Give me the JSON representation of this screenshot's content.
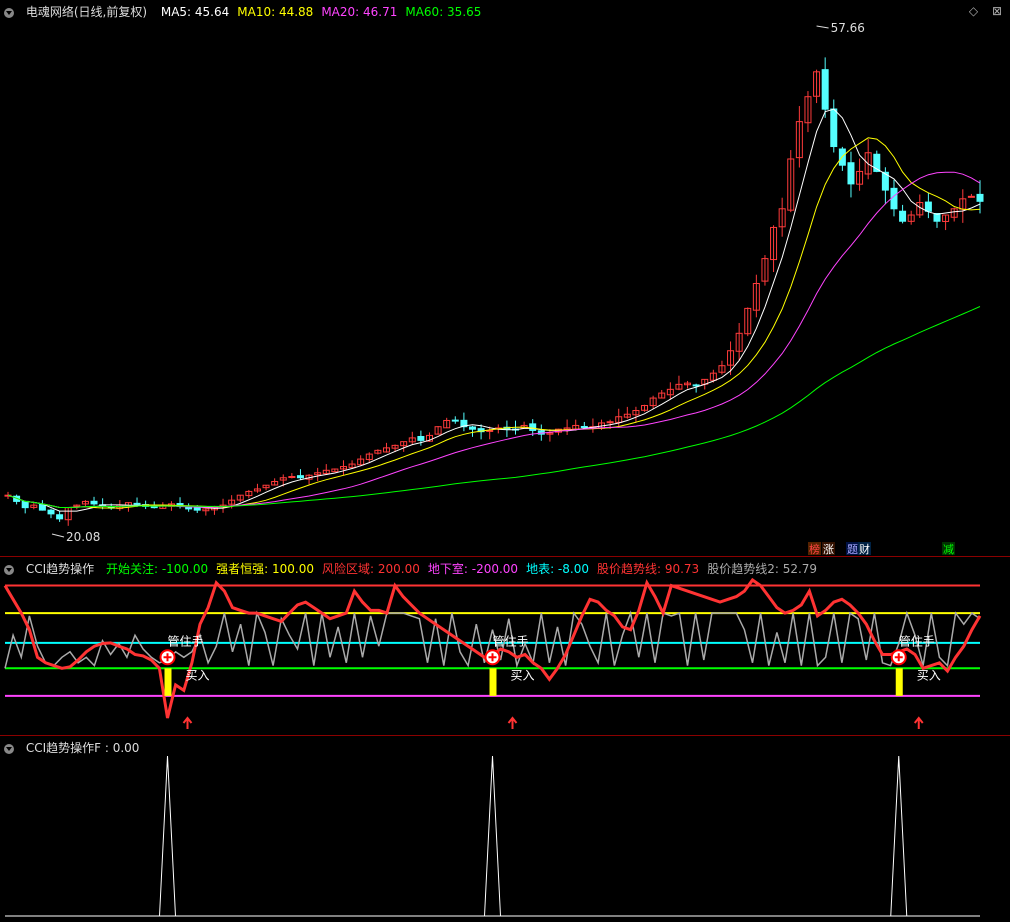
{
  "title": "电魂网络(日线,前复权)",
  "top_indicators": [
    {
      "label": "MA5: 45.64",
      "color": "#ffffff"
    },
    {
      "label": "MA10: 44.88",
      "color": "#ffff00"
    },
    {
      "label": "MA20: 46.71",
      "color": "#ff44ff"
    },
    {
      "label": "MA60: 35.65",
      "color": "#00ff00"
    }
  ],
  "top_right_icons": [
    "diamond-icon",
    "close-icon"
  ],
  "price_high_label": "57.66",
  "price_low_label": "20.08",
  "badges": [
    {
      "text": "榜",
      "color": "#ff4444",
      "bg": "#552200"
    },
    {
      "text": "涨",
      "color": "#ffffff",
      "bg": "#331100"
    },
    {
      "text": "题",
      "color": "#aaaaff",
      "bg": "#001144"
    },
    {
      "text": "财",
      "color": "#ffffff",
      "bg": "#002244"
    },
    {
      "text": "减",
      "color": "#00ff00",
      "bg": "#003300"
    }
  ],
  "cci_panel": {
    "title": "CCI趋势操作",
    "items": [
      {
        "label": "开始关注: -100.00",
        "color": "#00ff00"
      },
      {
        "label": "强者恒强: 100.00",
        "color": "#ffff00"
      },
      {
        "label": "风险区域: 200.00",
        "color": "#ff3333"
      },
      {
        "label": "地下室: -200.00",
        "color": "#ff44ff"
      },
      {
        "label": "地表: -8.00",
        "color": "#00ffff"
      },
      {
        "label": "股价趋势线: 90.73",
        "color": "#ff3333"
      },
      {
        "label": "股价趋势线2: 52.79",
        "color": "#aaaaaa"
      }
    ],
    "signal_label_1": "管住手",
    "signal_label_2": "买入"
  },
  "f_panel": {
    "title": "CCI趋势操作F",
    "value": ": 0.00"
  },
  "chart_data": [
    {
      "type": "candlestick",
      "title": "电魂网络(日线,前复权)",
      "high": 57.66,
      "low": 20.08,
      "ma_series": [
        {
          "name": "MA5",
          "value": 45.64,
          "color": "#ffffff"
        },
        {
          "name": "MA10",
          "value": 44.88,
          "color": "#ffff00"
        },
        {
          "name": "MA20",
          "value": 46.71,
          "color": "#ff44ff"
        },
        {
          "name": "MA60",
          "value": 35.65,
          "color": "#00ff00"
        }
      ],
      "close_approx": [
        22,
        21.5,
        21,
        21.2,
        20.8,
        20.5,
        20.1,
        21,
        21.2,
        21.5,
        21.3,
        21.1,
        21,
        21.2,
        21.4,
        21.3,
        21.1,
        21,
        21.2,
        21.3,
        21.1,
        20.9,
        20.8,
        20.9,
        21,
        21.2,
        21.6,
        22,
        22.3,
        22.5,
        22.8,
        23.1,
        23.4,
        23.5,
        23.4,
        23.6,
        23.8,
        24,
        24.1,
        24.3,
        24.5,
        24.9,
        25.3,
        25.6,
        25.8,
        26,
        26.3,
        26.6,
        26.4,
        26.8,
        27.5,
        28,
        28,
        27.5,
        27.3,
        27.1,
        27.2,
        27.4,
        27.3,
        27.3,
        27.6,
        27.2,
        26.9,
        27,
        27.3,
        27.4,
        27.6,
        27.5,
        27.5,
        27.8,
        27.9,
        28.3,
        28.5,
        28.8,
        29.2,
        29.8,
        30.2,
        30.5,
        30.9,
        31,
        30.8,
        31.3,
        31.8,
        32.4,
        33.6,
        35,
        37,
        39,
        41,
        43.5,
        45,
        49,
        52,
        54,
        56,
        53,
        50,
        48.5,
        47,
        48,
        49.5,
        48,
        46.5,
        45,
        44,
        44.5,
        45.5,
        44.8,
        44,
        44.5,
        45,
        45.8,
        46,
        45.6
      ]
    },
    {
      "type": "line",
      "title": "CCI趋势操作",
      "reference_lines": [
        {
          "name": "风险区域",
          "value": 200,
          "color": "#ff3333"
        },
        {
          "name": "强者恒强",
          "value": 100,
          "color": "#ffff00"
        },
        {
          "name": "地表",
          "value": -8,
          "color": "#00ffff"
        },
        {
          "name": "开始关注",
          "value": -100,
          "color": "#00ff00"
        },
        {
          "name": "地下室",
          "value": -200,
          "color": "#ff44ff"
        }
      ],
      "series": [
        {
          "name": "股价趋势线",
          "last": 90.73,
          "color": "#ff3333",
          "values": [
            200,
            150,
            100,
            40,
            -60,
            -80,
            -90,
            -100,
            -95,
            -70,
            -40,
            -20,
            -10,
            -8,
            -20,
            -30,
            -50,
            -55,
            -70,
            -100,
            -280,
            -160,
            -180,
            -80,
            60,
            120,
            210,
            180,
            120,
            110,
            100,
            100,
            90,
            80,
            70,
            100,
            130,
            140,
            120,
            100,
            80,
            90,
            100,
            180,
            140,
            110,
            110,
            100,
            200,
            160,
            130,
            100,
            80,
            60,
            40,
            20,
            0,
            -20,
            -40,
            -60,
            -50,
            -30,
            -40,
            -60,
            -50,
            -80,
            -100,
            -140,
            -100,
            -50,
            20,
            90,
            150,
            140,
            110,
            90,
            50,
            40,
            110,
            210,
            160,
            100,
            200,
            190,
            180,
            170,
            160,
            150,
            140,
            150,
            160,
            180,
            220,
            200,
            160,
            120,
            100,
            110,
            130,
            180,
            90,
            110,
            140,
            150,
            130,
            100,
            60,
            0,
            -50,
            -50,
            -40,
            -30,
            -50,
            -100,
            -90,
            -80,
            -110,
            -60,
            -20,
            40,
            90
          ]
        },
        {
          "name": "股价趋势线2",
          "last": 52.79,
          "color": "#aaaaaa",
          "values": [
            -100,
            20,
            -60,
            90,
            -20,
            -80,
            -90,
            -60,
            -40,
            -80,
            -60,
            -90,
            0,
            -50,
            -10,
            -60,
            20,
            -30,
            -60,
            -80,
            -70,
            -40,
            -60,
            -40,
            20,
            -80,
            -20,
            100,
            -40,
            60,
            -90,
            100,
            30,
            -90,
            80,
            20,
            -30,
            100,
            -90,
            100,
            -60,
            50,
            -80,
            100,
            -60,
            90,
            -20,
            100,
            100,
            100,
            90,
            80,
            -80,
            80,
            -90,
            100,
            -40,
            -90,
            60,
            -80,
            40,
            -70,
            80,
            -90,
            -10,
            -80,
            100,
            -80,
            50,
            -90,
            100,
            60,
            -20,
            -80,
            100,
            -90,
            20,
            100,
            -60,
            100,
            -80,
            100,
            90,
            100,
            -90,
            100,
            -70,
            100,
            100,
            100,
            100,
            40,
            -80,
            100,
            -90,
            30,
            -80,
            100,
            -90,
            100,
            -90,
            -60,
            100,
            -80,
            100,
            80,
            -70,
            100,
            -80,
            -90,
            -10,
            100,
            20,
            -90,
            100,
            -60,
            -90,
            100,
            60,
            100,
            80
          ]
        }
      ],
      "signals": [
        {
          "index": 20,
          "label": "管住手",
          "buy_label": "买入"
        },
        {
          "index": 60,
          "label": "管住手",
          "buy_label": "买入"
        },
        {
          "index": 110,
          "label": "管住手",
          "buy_label": "买入"
        }
      ]
    },
    {
      "type": "line",
      "title": "CCI趋势操作F",
      "value": 0.0,
      "spike_indices": [
        20,
        60,
        110
      ]
    }
  ]
}
